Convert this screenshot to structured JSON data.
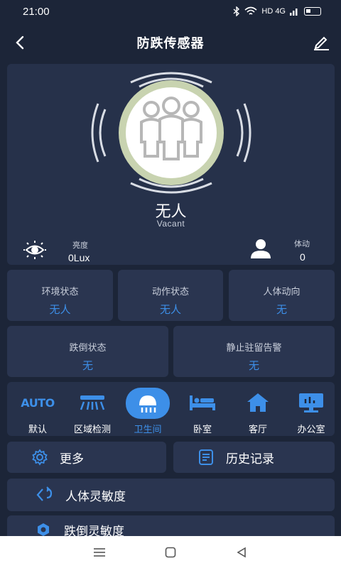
{
  "status_bar": {
    "time": "21:00",
    "signal_text": "HD 4G"
  },
  "header": {
    "title": "防跌传感器"
  },
  "presence": {
    "state_cn": "无人",
    "state_en": "Vacant"
  },
  "brightness": {
    "label": "亮度",
    "value": "0Lux"
  },
  "movement": {
    "label": "体动",
    "value": "0"
  },
  "cards": [
    {
      "label": "环境状态",
      "value": "无人"
    },
    {
      "label": "动作状态",
      "value": "无人"
    },
    {
      "label": "人体动向",
      "value": "无"
    },
    {
      "label": "跌倒状态",
      "value": "无"
    },
    {
      "label": "静止驻留告警",
      "value": "无"
    }
  ],
  "modes": [
    {
      "label": "默认",
      "icon": "auto-icon"
    },
    {
      "label": "区域检测",
      "icon": "region-detect-icon"
    },
    {
      "label": "卫生间",
      "icon": "shower-icon",
      "active": true
    },
    {
      "label": "卧室",
      "icon": "bed-icon"
    },
    {
      "label": "客厅",
      "icon": "home-icon"
    },
    {
      "label": "办公室",
      "icon": "monitor-icon"
    }
  ],
  "mode_auto_text": "AUTO",
  "actions": {
    "more": "更多",
    "history": "历史记录",
    "body_sensitivity": "人体灵敏度",
    "fall_sensitivity": "跌倒灵敏度"
  },
  "colors": {
    "accent": "#3d8fe8",
    "background": "#1c2538",
    "card": "#2a3550",
    "ring": "#c8d3b0"
  }
}
